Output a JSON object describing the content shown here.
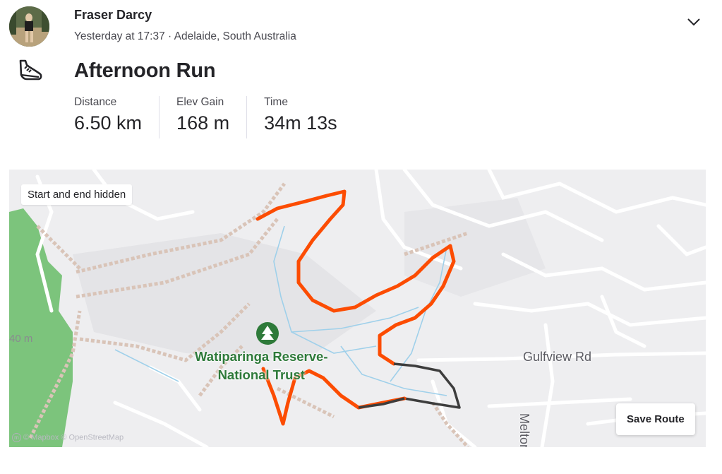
{
  "header": {
    "athlete_name": "Fraser Darcy",
    "meta": "Yesterday at 17:37 · Adelaide, South Australia",
    "menu_icon": "chevron-down-icon"
  },
  "activity": {
    "type_icon": "running-shoe-icon",
    "title": "Afternoon Run",
    "stats": [
      {
        "label": "Distance",
        "value": "6.50 km"
      },
      {
        "label": "Elev Gain",
        "value": "168 m"
      },
      {
        "label": "Time",
        "value": "34m 13s"
      }
    ]
  },
  "map": {
    "privacy_badge": "Start and end hidden",
    "save_button": "Save Route",
    "park_label_line1": "Watiparinga Reserve-",
    "park_label_line2": "National Trust",
    "road_label_1": "Gulfview Rd",
    "road_label_2": "Melton",
    "contour_label": "40 m",
    "attribution": "© Mapbox © OpenStreetMap",
    "route_color": "#fc4c02",
    "hidden_route_color": "#3d3d3d",
    "park_color": "#7cc47c"
  }
}
